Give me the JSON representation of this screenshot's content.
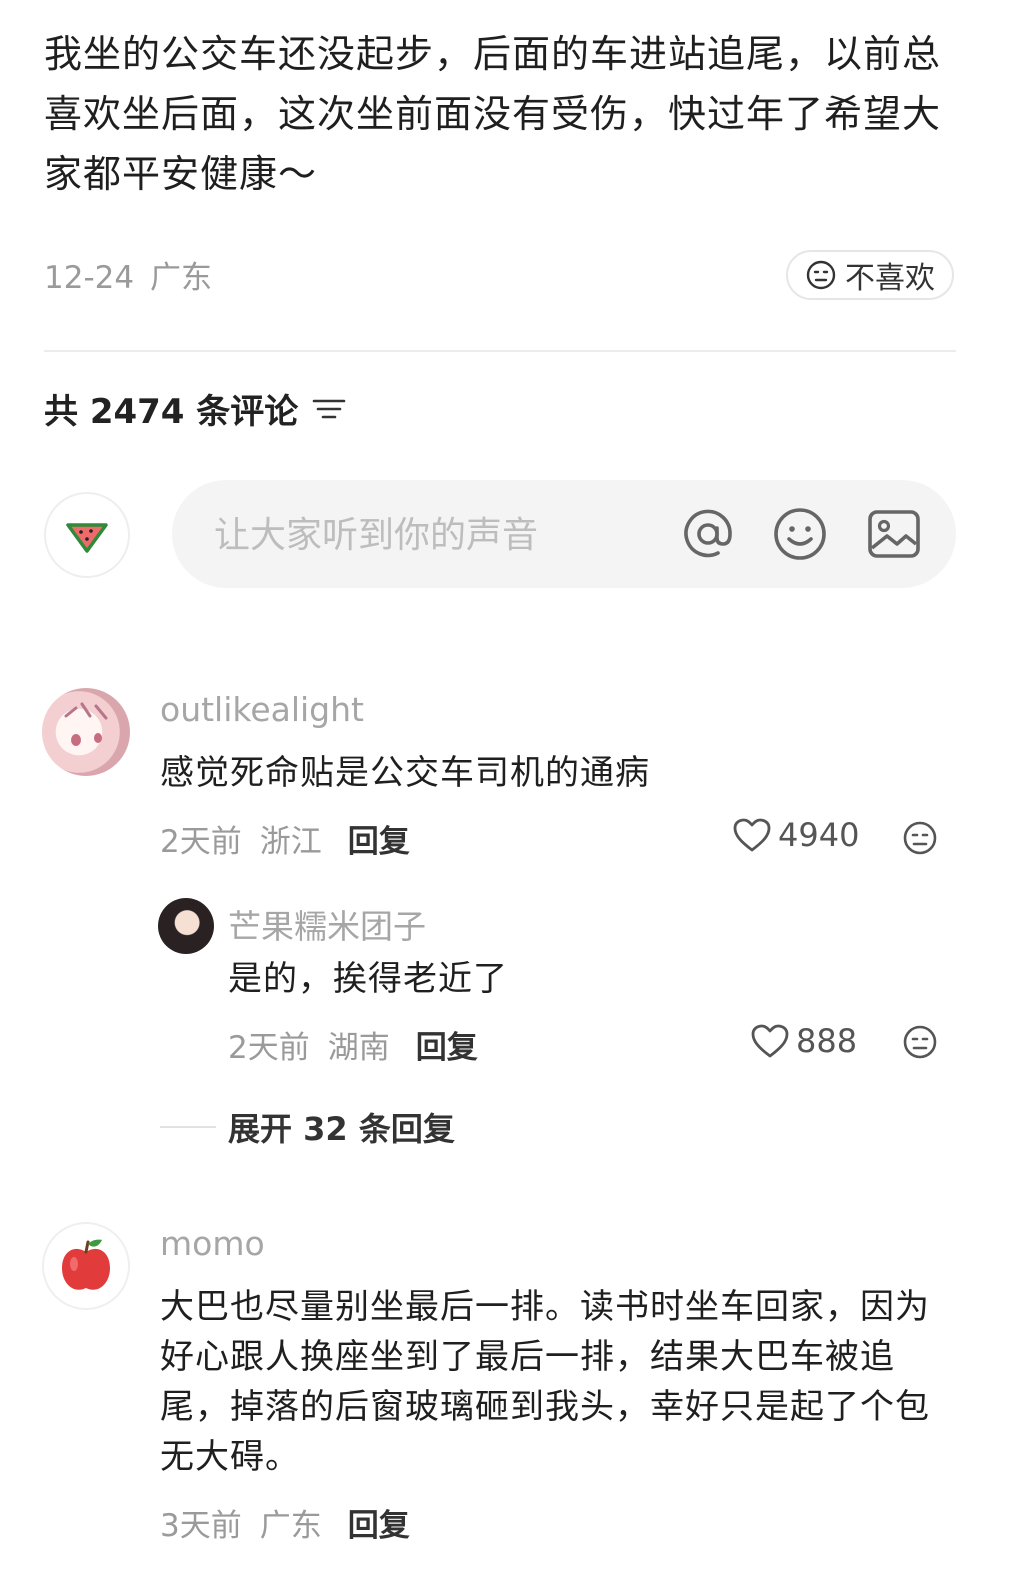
{
  "post": {
    "text": "我坐的公交车还没起步，后面的车进站追尾，以前总喜欢坐后面，这次坐前面没有受伤，快过年了希望大家都平安健康～",
    "date": "12-24",
    "location": "广东",
    "dislike_label": "不喜欢"
  },
  "comments_header": {
    "label": "共 2474 条评论"
  },
  "input": {
    "placeholder": "让大家听到你的声音"
  },
  "comments": [
    {
      "username": "outlikealight",
      "text": "感觉死命贴是公交车司机的通病",
      "time": "2天前",
      "location": "浙江",
      "reply_label": "回复",
      "likes": "4940"
    },
    {
      "username": "momo",
      "text": "大巴也尽量别坐最后一排。读书时坐车回家，因为好心跟人换座坐到了最后一排，结果大巴车被追尾，掉落的后窗玻璃砸到我头，幸好只是起了个包无大碍。",
      "time": "3天前",
      "location": "广东",
      "reply_label": "回复"
    }
  ],
  "reply": {
    "username": "芒果糯米团子",
    "text": "是的，挨得老近了",
    "time": "2天前",
    "location": "湖南",
    "reply_label": "回复",
    "likes": "888"
  },
  "expand": {
    "label": "展开 32 条回复"
  },
  "icons": {
    "dislike": "neutral-face-icon",
    "sort": "sort-lines-icon",
    "mention": "at-icon",
    "emoji": "smile-icon",
    "image": "image-icon",
    "like": "heart-outline-icon",
    "watermelon": "watermelon-icon",
    "apple": "apple-icon"
  },
  "colors": {
    "text": "#1f1f1f",
    "meta": "#9a9a9a",
    "input_bg": "#f4f4f4"
  }
}
